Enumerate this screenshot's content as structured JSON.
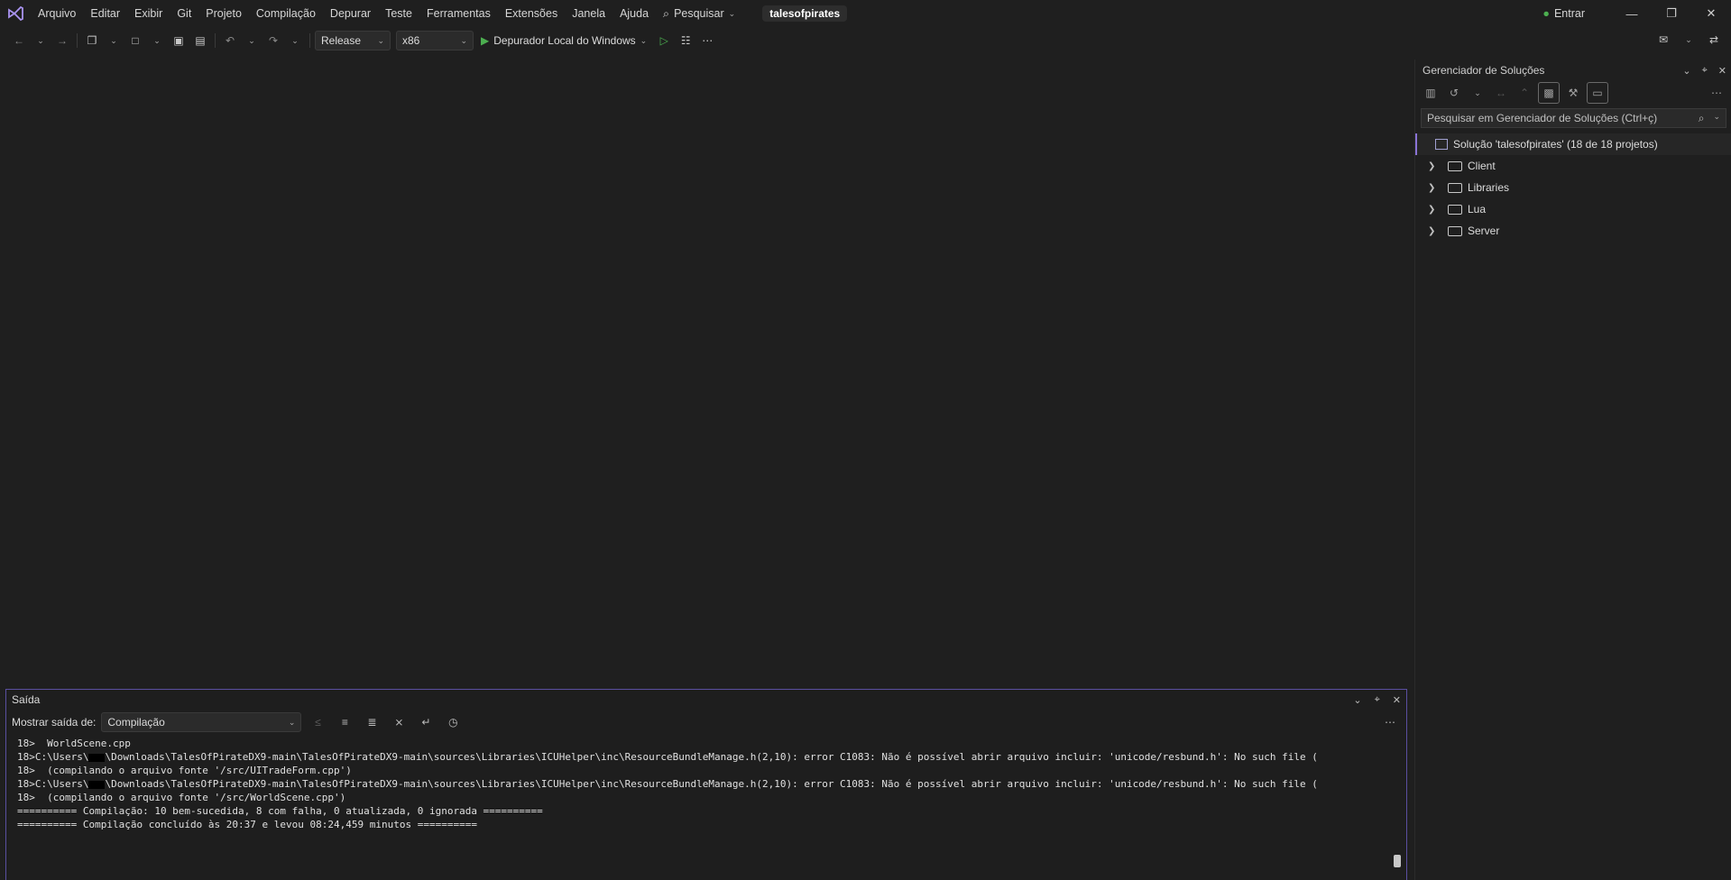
{
  "menu": {
    "items": [
      "Arquivo",
      "Editar",
      "Exibir",
      "Git",
      "Projeto",
      "Compilação",
      "Depurar",
      "Teste",
      "Ferramentas",
      "Extensões",
      "Janela",
      "Ajuda"
    ],
    "search_label": "Pesquisar",
    "project_name": "talesofpirates",
    "sign_in": "Entrar"
  },
  "toolbar": {
    "configuration": "Release",
    "platform": "x86",
    "debugger": "Depurador Local do Windows"
  },
  "solution_explorer": {
    "title": "Gerenciador de Soluções",
    "search_placeholder": "Pesquisar em Gerenciador de Soluções (Ctrl+ç)",
    "root": "Solução 'talesofpirates' (18 de 18 projetos)",
    "folders": [
      "Client",
      "Libraries",
      "Lua",
      "Server"
    ]
  },
  "output": {
    "title": "Saída",
    "show_from_label": "Mostrar saída de:",
    "source": "Compilação",
    "lines": {
      "l1": "18>  WorldScene.cpp",
      "l2a": "18>C:\\Users\\",
      "l2b": "\\Downloads\\TalesOfPirateDX9-main\\TalesOfPirateDX9-main\\sources\\Libraries\\ICUHelper\\inc\\ResourceBundleManage.h(2,10): error C1083: Não é possível abrir arquivo incluir: 'unicode/resbund.h': No such file (",
      "l3": "18>  (compilando o arquivo fonte '/src/UITradeForm.cpp')",
      "l4a": "18>C:\\Users\\",
      "l4b": "\\Downloads\\TalesOfPirateDX9-main\\TalesOfPirateDX9-main\\sources\\Libraries\\ICUHelper\\inc\\ResourceBundleManage.h(2,10): error C1083: Não é possível abrir arquivo incluir: 'unicode/resbund.h': No such file (",
      "l5": "18>  (compilando o arquivo fonte '/src/WorldScene.cpp')",
      "l6": "========== Compilação: 10 bem-sucedida, 8 com falha, 0 atualizada, 0 ignorada ==========",
      "l7": "========== Compilação concluído às 20:37 e levou 08:24,459 minutos =========="
    }
  }
}
